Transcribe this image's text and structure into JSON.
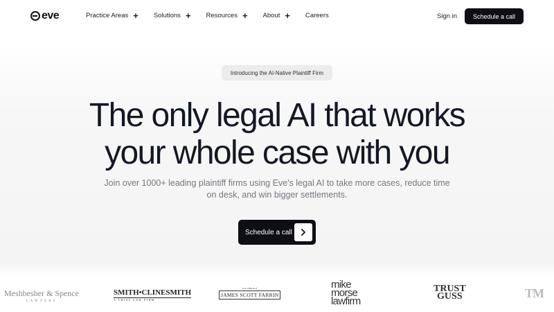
{
  "brand": {
    "name": "eve"
  },
  "nav": {
    "links": [
      {
        "label": "Practice Areas",
        "has_plus": true
      },
      {
        "label": "Solutions",
        "has_plus": true
      },
      {
        "label": "Resources",
        "has_plus": true
      },
      {
        "label": "About",
        "has_plus": true
      },
      {
        "label": "Careers",
        "has_plus": false
      }
    ],
    "plus_glyph": "+",
    "signin_label": "Sign in",
    "cta_label": "Schedule a call"
  },
  "hero": {
    "badge": "Introducing the AI-Native Plaintiff Firm",
    "headline_line1": "The only legal AI that works",
    "headline_line2": "your whole case with you",
    "subtitle": "Join over 1000+ leading plaintiff firms using Eve's legal AI to take more cases, reduce time on desk, and win bigger settlements.",
    "cta_label": "Schedule a call",
    "cta_icon": "chevron-right-icon"
  },
  "clients": [
    {
      "name": "Meshbesher & Spence",
      "tagline": "LAWYERS"
    },
    {
      "name": "SMITH•CLINESMITH",
      "tagline": "A TRIAL LAW FIRM"
    },
    {
      "name": "JAMES SCOTT FARRIN",
      "tagline": "Law Offices of"
    },
    {
      "name_line1": "mike",
      "name_line2": "morse",
      "name_line3": "lawfirm"
    },
    {
      "name_line1": "TRUST",
      "name_line2": "GUSS"
    },
    {
      "name": "TM"
    }
  ],
  "colors": {
    "primary_dark": "#0d0f14",
    "headline": "#141824",
    "subtitle": "#75787f",
    "badge_bg": "#ececec"
  }
}
